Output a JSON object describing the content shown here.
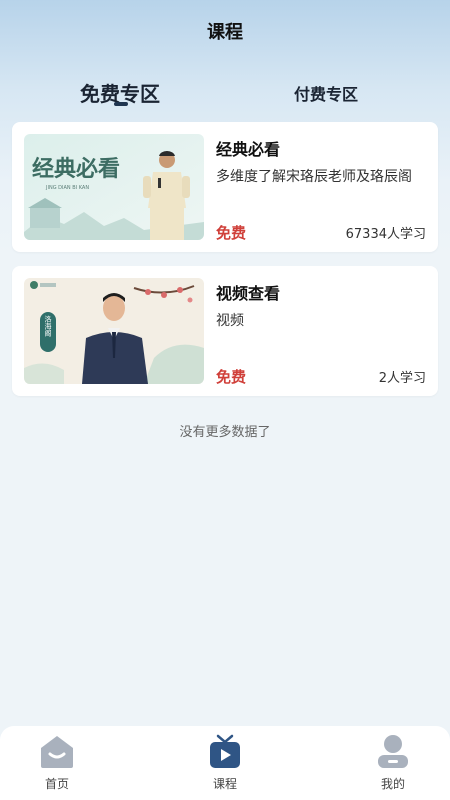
{
  "header": {
    "title": "课程"
  },
  "tabs": [
    {
      "label": "免费专区",
      "active": true
    },
    {
      "label": "付费专区",
      "active": false
    }
  ],
  "courses": [
    {
      "title": "经典必看",
      "subtitle": "多维度了解宋珞辰老师及珞辰阁",
      "price": "免费",
      "learners": "67334人学习",
      "thumb_text": "经典必看",
      "thumb_pinyin": "JING DIAN BI KAN"
    },
    {
      "title": "视频查看",
      "subtitle": "视频",
      "price": "免费",
      "learners": "2人学习",
      "thumb_badge": "洛海阁"
    }
  ],
  "list_footer": "没有更多数据了",
  "tabbar": [
    {
      "label": "首页",
      "icon": "home-icon"
    },
    {
      "label": "课程",
      "icon": "tv-icon",
      "active": true
    },
    {
      "label": "我的",
      "icon": "user-icon"
    }
  ],
  "colors": {
    "accent": "#d0403a",
    "active_icon": "#2f5585",
    "inactive_icon": "#a9b1bd"
  }
}
